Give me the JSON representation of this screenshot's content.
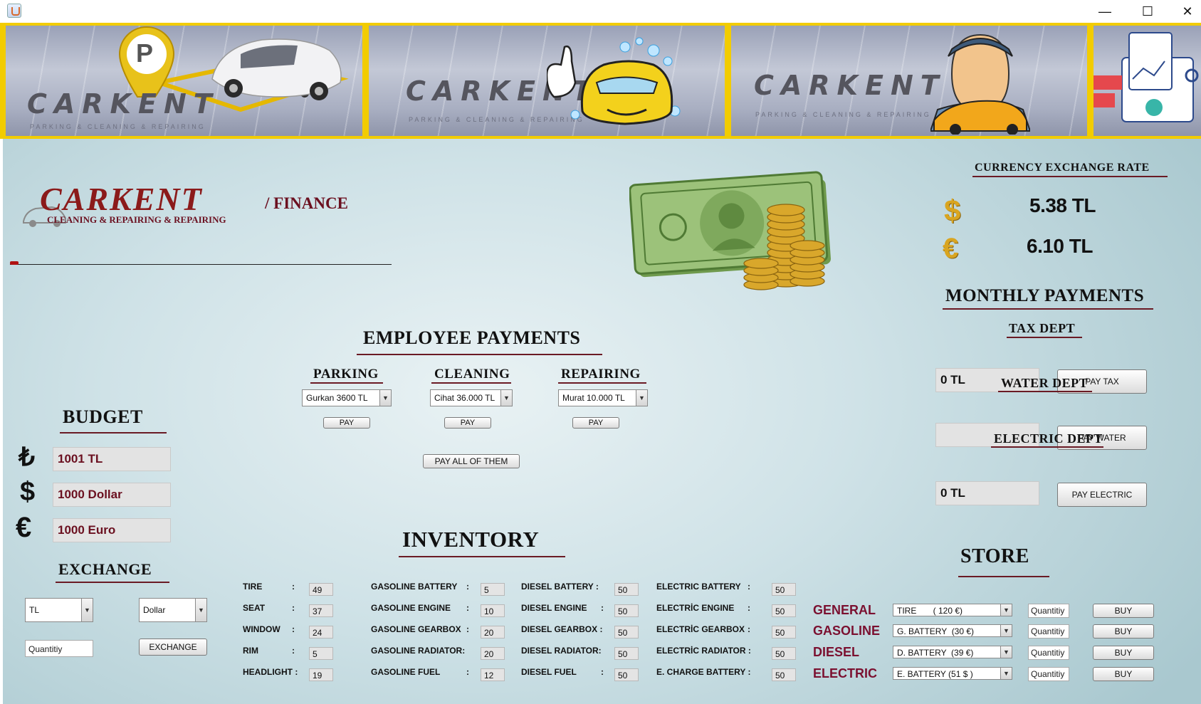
{
  "window": {
    "title": ""
  },
  "banner": {
    "panels": [
      {
        "brand": "CARKENT",
        "tagline": "PARKING & CLEANING & REPAIRING"
      },
      {
        "brand": "CARKENT",
        "tagline": "PARKING & CLEANING & REPAIRING"
      },
      {
        "brand": "CARKENT",
        "tagline": "PARKING & CLEANING & REPAIRING"
      }
    ],
    "parking_letter": "P"
  },
  "logo": {
    "brand": "CARKENT",
    "section": "/ FINANCE",
    "subtitle": "CLEANING & REPAIRING & REPAIRING"
  },
  "currency": {
    "title": "CURRENCY EXCHANGE RATE",
    "dollar_rate": "5.38 TL",
    "euro_rate": "6.10  TL",
    "dollar_symbol": "$",
    "euro_symbol": "€"
  },
  "monthly": {
    "title": "MONTHLY PAYMENTS",
    "tax": {
      "label": "TAX DEPT",
      "value": "0 TL",
      "button": "PAY TAX"
    },
    "water": {
      "label": "WATER DEPT",
      "value": "",
      "button": "PAY WATER"
    },
    "electric": {
      "label": "ELECTRIC DEPT",
      "value": "0 TL",
      "button": "PAY ELECTRIC"
    }
  },
  "employee": {
    "title": "EMPLOYEE PAYMENTS",
    "parking": {
      "label": "PARKING",
      "selected": "Gurkan 3600 TL",
      "button": "PAY"
    },
    "cleaning": {
      "label": "CLEANING",
      "selected": "Cihat 36.000 TL",
      "button": "PAY"
    },
    "repairing": {
      "label": "REPAIRING",
      "selected": "Murat 10.000 TL",
      "button": "PAY"
    },
    "pay_all": "PAY ALL OF THEM"
  },
  "budget": {
    "title": "BUDGET",
    "tl": {
      "symbol": "₺",
      "value": "1001 TL"
    },
    "dollar": {
      "symbol": "$",
      "value": "1000 Dollar"
    },
    "euro": {
      "symbol": "€",
      "value": "1000 Euro"
    }
  },
  "exchange": {
    "title": "EXCHANGE",
    "from": "TL",
    "to": "Dollar",
    "quantity_value": "Quantitiy",
    "button": "EXCHANGE"
  },
  "inventory": {
    "title": "INVENTORY",
    "general": [
      {
        "label": "TIRE",
        "colon": ":",
        "value": "49"
      },
      {
        "label": "SEAT",
        "colon": ":",
        "value": "37"
      },
      {
        "label": "WINDOW",
        "colon": ":",
        "value": "24"
      },
      {
        "label": "RIM",
        "colon": ":",
        "value": "5"
      },
      {
        "label": "HEADLIGHT :",
        "colon": "",
        "value": "19"
      }
    ],
    "gasoline": [
      {
        "label": "GASOLINE BATTERY",
        "colon": ":",
        "value": "5"
      },
      {
        "label": "GASOLINE ENGINE",
        "colon": ":",
        "value": "10"
      },
      {
        "label": "GASOLINE GEARBOX",
        "colon": ":",
        "value": "20"
      },
      {
        "label": "GASOLINE RADIATOR:",
        "colon": "",
        "value": "20"
      },
      {
        "label": "GASOLINE FUEL",
        "colon": ":",
        "value": "12"
      }
    ],
    "diesel": [
      {
        "label": "DIESEL BATTERY :",
        "colon": "",
        "value": "50"
      },
      {
        "label": "DIESEL ENGINE",
        "colon": ":",
        "value": "50"
      },
      {
        "label": "DIESEL GEARBOX :",
        "colon": "",
        "value": "50"
      },
      {
        "label": "DIESEL RADIATOR:",
        "colon": "",
        "value": "50"
      },
      {
        "label": "DIESEL FUEL",
        "colon": ":",
        "value": "50"
      }
    ],
    "electric": [
      {
        "label": "ELECTRIC BATTERY",
        "colon": ":",
        "value": "50"
      },
      {
        "label": "ELECTRİC ENGINE",
        "colon": ":",
        "value": "50"
      },
      {
        "label": "ELECTRİC GEARBOX",
        "colon": ":",
        "value": "50"
      },
      {
        "label": "ELECTRİC RADIATOR :",
        "colon": "",
        "value": "50"
      },
      {
        "label": "E. CHARGE BATTERY :",
        "colon": "",
        "value": "50"
      }
    ]
  },
  "store": {
    "title": "STORE",
    "rows": [
      {
        "category": "GENERAL",
        "selected": "TIRE       ( 120 €)",
        "quantity": "Quantitiy",
        "button": "BUY"
      },
      {
        "category": "GASOLINE",
        "selected": "G. BATTERY  (30 €)",
        "quantity": "Quantitiy",
        "button": "BUY"
      },
      {
        "category": "DIESEL",
        "selected": "D. BATTERY  (39 €)",
        "quantity": "Quantitiy",
        "button": "BUY"
      },
      {
        "category": "ELECTRIC",
        "selected": "E. BATTERY (51 $ )",
        "quantity": "Quantitiy",
        "button": "BUY"
      }
    ]
  },
  "icons": {
    "window_minimize": "—",
    "window_maximize": "☐",
    "window_close": "✕",
    "dropdown_arrow": "▼"
  },
  "colors": {
    "accent": "#6b1020",
    "banner_border": "#f2cc00"
  }
}
